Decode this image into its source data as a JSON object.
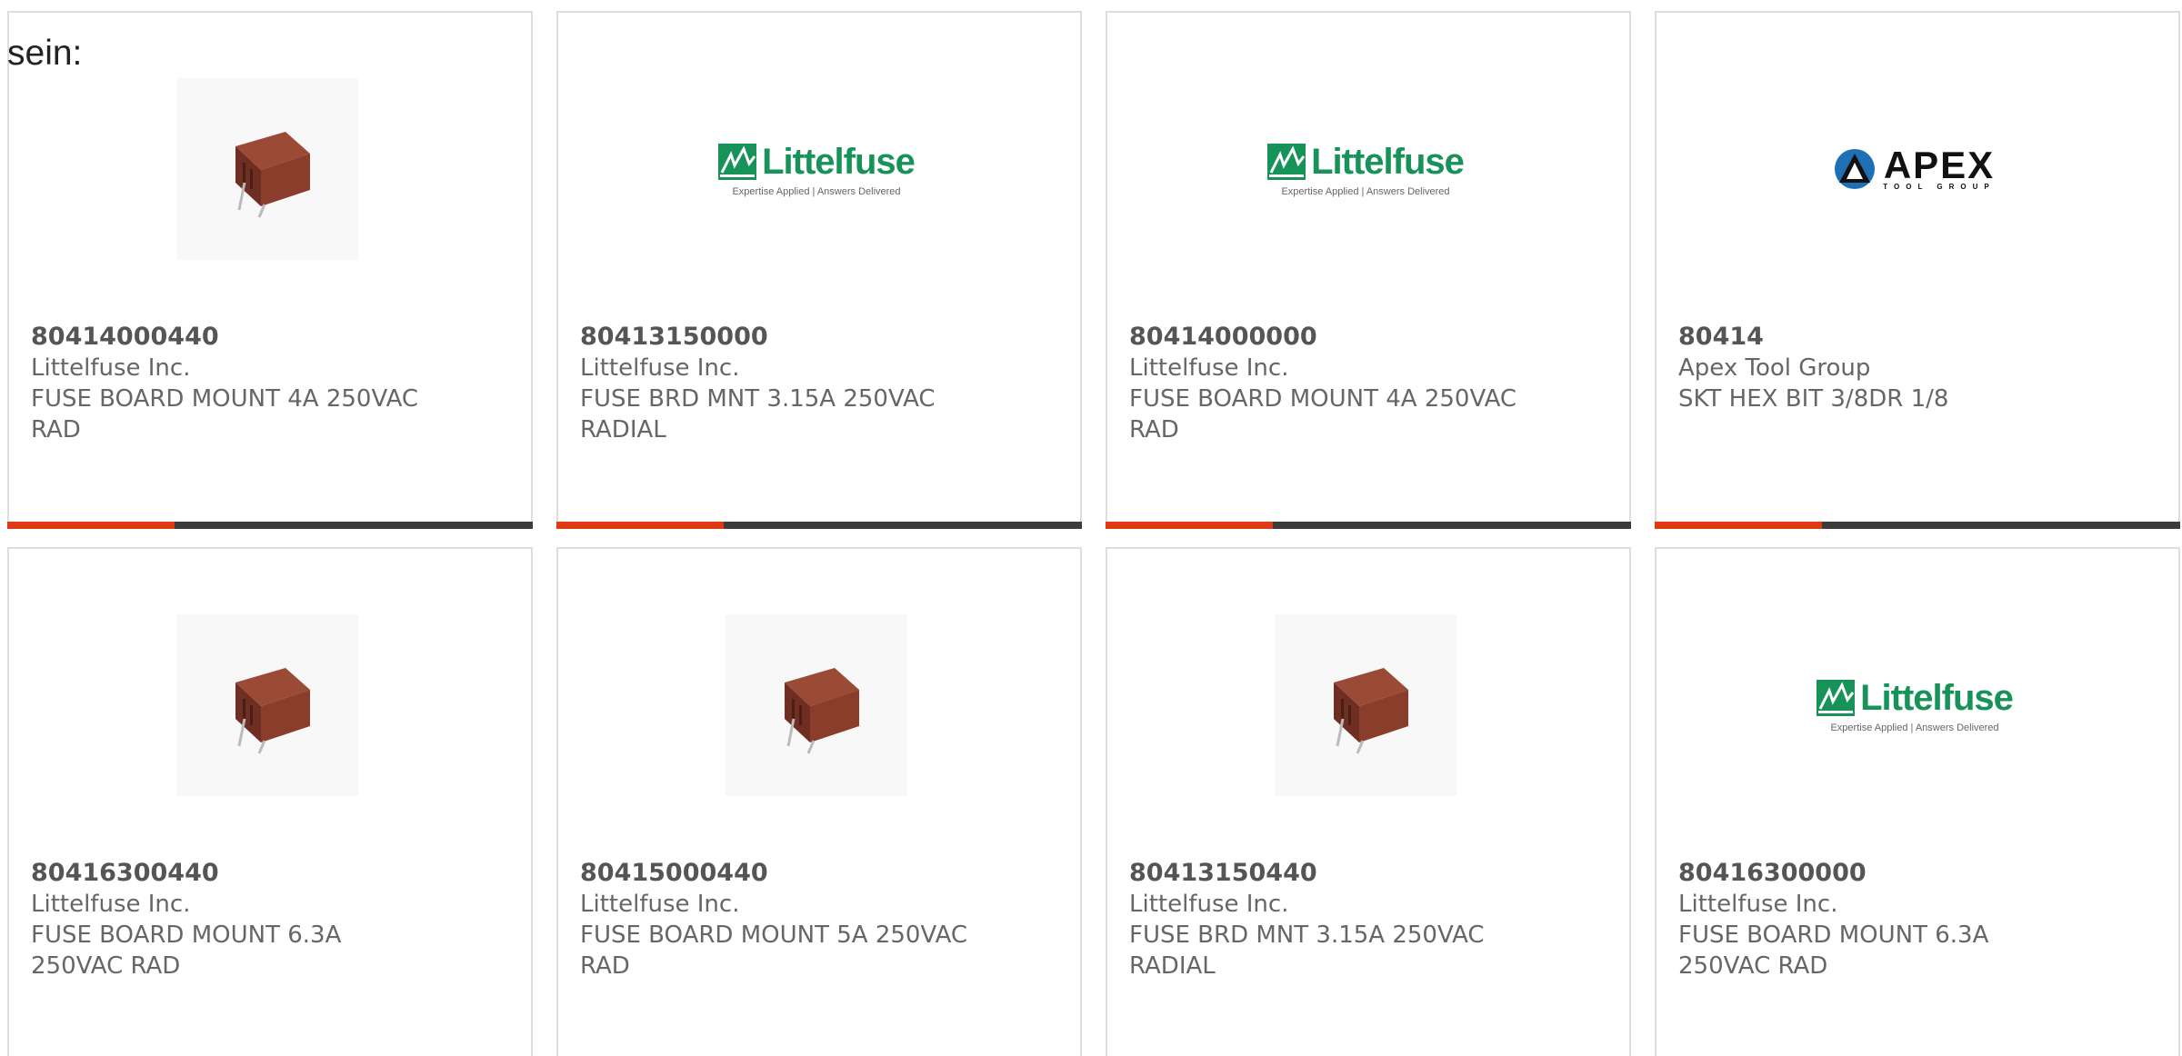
{
  "intro_text": "sein:",
  "colors": {
    "accent": "#e03a12",
    "bar_dark": "#3c3c3c",
    "brand_littelfuse": "#17935a",
    "text_muted": "#666666"
  },
  "logos": {
    "littelfuse": {
      "name": "Littelfuse",
      "tagline": "Expertise Applied | Answers Delivered"
    },
    "apex": {
      "name": "APEX",
      "sub": "TOOL GROUP"
    }
  },
  "products": [
    {
      "part": "80414000440",
      "maker": "Littelfuse Inc.",
      "desc1": "FUSE BOARD MOUNT 4A 250VAC",
      "desc2": "RAD",
      "image": "fuse-photo"
    },
    {
      "part": "80413150000",
      "maker": "Littelfuse Inc.",
      "desc1": "FUSE BRD MNT 3.15A 250VAC",
      "desc2": "RADIAL",
      "image": "littelfuse-logo"
    },
    {
      "part": "80414000000",
      "maker": "Littelfuse Inc.",
      "desc1": "FUSE BOARD MOUNT 4A 250VAC",
      "desc2": "RAD",
      "image": "littelfuse-logo"
    },
    {
      "part": "80414",
      "maker": "Apex Tool Group",
      "desc1": "SKT HEX BIT 3/8DR 1/8",
      "desc2": "",
      "image": "apex-logo"
    },
    {
      "part": "80416300440",
      "maker": "Littelfuse Inc.",
      "desc1": "FUSE BOARD MOUNT 6.3A",
      "desc2": "250VAC RAD",
      "image": "fuse-photo"
    },
    {
      "part": "80415000440",
      "maker": "Littelfuse Inc.",
      "desc1": "FUSE BOARD MOUNT 5A 250VAC",
      "desc2": "RAD",
      "image": "fuse-photo"
    },
    {
      "part": "80413150440",
      "maker": "Littelfuse Inc.",
      "desc1": "FUSE BRD MNT 3.15A 250VAC",
      "desc2": "RADIAL",
      "image": "fuse-photo"
    },
    {
      "part": "80416300000",
      "maker": "Littelfuse Inc.",
      "desc1": "FUSE BOARD MOUNT 6.3A",
      "desc2": "250VAC RAD",
      "image": "littelfuse-logo"
    }
  ]
}
